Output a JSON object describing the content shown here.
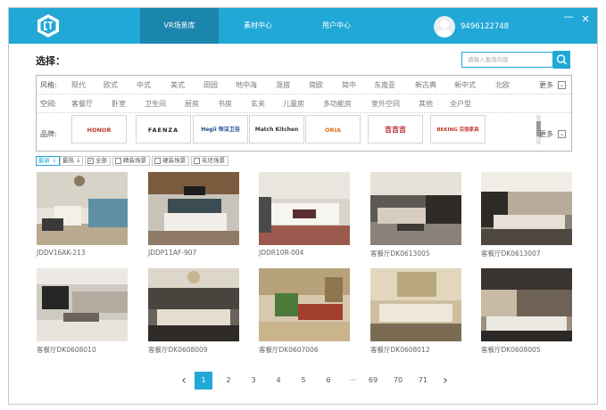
{
  "header": {
    "tabs": [
      {
        "label": "VR场景库",
        "active": true
      },
      {
        "label": "素材中心",
        "active": false
      },
      {
        "label": "用户中心",
        "active": false
      }
    ],
    "username": "9496122748",
    "window_controls": {
      "minimize": "—",
      "close": "✕"
    }
  },
  "selection": {
    "title": "选择：",
    "search_placeholder": "请输入查询内容"
  },
  "filters": {
    "style": {
      "label": "风格:",
      "items": [
        "现代",
        "欧式",
        "中式",
        "美式",
        "田园",
        "地中海",
        "混搭",
        "简欧",
        "简中",
        "东南亚",
        "新古典",
        "新中式",
        "北欧"
      ]
    },
    "space": {
      "label": "空间:",
      "items": [
        "客餐厅",
        "卧室",
        "卫生间",
        "厨房",
        "书房",
        "玄关",
        "儿童房",
        "多功能房",
        "室外空间",
        "其他",
        "全户型"
      ]
    },
    "brand": {
      "label": "品牌:",
      "items": [
        "HONOR",
        "FAENZA",
        "Hegii 恒洁卫浴",
        "Match Kitchen",
        "ORIA",
        "吉吉吉",
        "BEKING 百强家具"
      ]
    },
    "more_label": "更多"
  },
  "sort": {
    "newest": "最新",
    "hottest": "最热",
    "all": "全部",
    "fine": "精装场景",
    "hard": "硬装场景",
    "rough": "毛坯场景"
  },
  "grid": [
    {
      "caption": "JDDV16AK-213"
    },
    {
      "caption": "JDDP11AF-907"
    },
    {
      "caption": "JDDR10R-004"
    },
    {
      "caption": "客餐厅DK0613005"
    },
    {
      "caption": "客餐厅DK0613007"
    },
    {
      "caption": "客餐厅DK0608010"
    },
    {
      "caption": "客餐厅DK0608009"
    },
    {
      "caption": "客餐厅DK0607006"
    },
    {
      "caption": "客餐厅DK0608012"
    },
    {
      "caption": "客餐厅DK0608005"
    }
  ],
  "pagination": {
    "pages": [
      "1",
      "2",
      "3",
      "4",
      "5",
      "6",
      "69",
      "70",
      "71"
    ],
    "current": "1",
    "ellipsis": "···",
    "prev": "‹",
    "next": "›"
  },
  "colors": {
    "accent": "#21a8d7",
    "accent_dark": "#1b86ad"
  }
}
